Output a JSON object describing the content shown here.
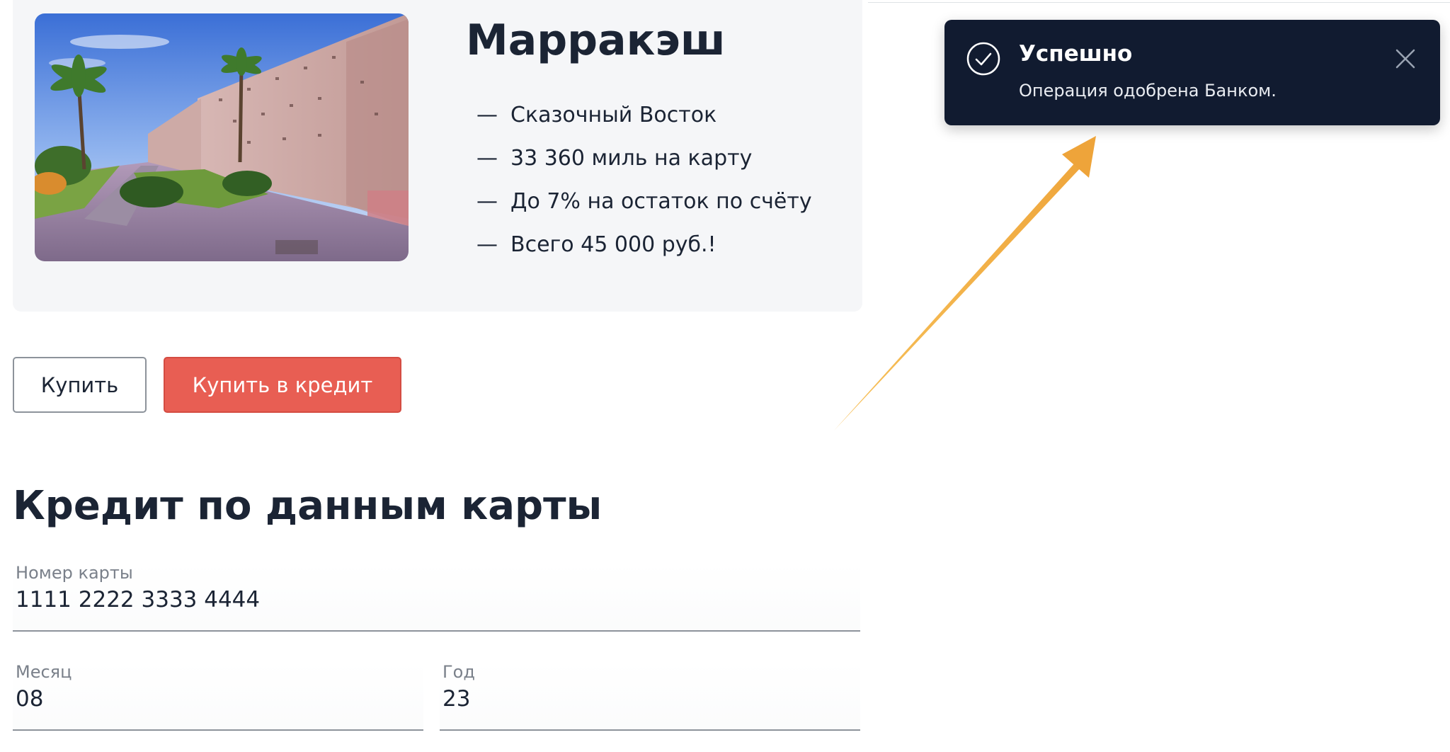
{
  "product": {
    "title": "Марракэш",
    "image_icon": "city-wall-photo",
    "features": [
      {
        "dash": "—",
        "text": "Сказочный Восток"
      },
      {
        "dash": "—",
        "text": "33 360 миль на карту"
      },
      {
        "dash": "—",
        "text": "До 7% на остаток по счёту"
      },
      {
        "dash": "—",
        "text": "Всего 45 000 руб.!"
      }
    ]
  },
  "actions": {
    "buy_label": "Купить",
    "buy_credit_label": "Купить в кредит"
  },
  "credit_form": {
    "title": "Кредит по данным карты",
    "card_number": {
      "label": "Номер карты",
      "value": "1111 2222 3333 4444"
    },
    "month": {
      "label": "Месяц",
      "value": "08"
    },
    "year": {
      "label": "Год",
      "value": "23"
    }
  },
  "notification": {
    "title": "Успешно",
    "message": "Операция одобрена Банком.",
    "icon": "check-circle-icon",
    "close_icon": "close-icon"
  },
  "colors": {
    "card_background": "#f5f6f8",
    "text_primary": "#1b2434",
    "accent_red": "#e85e53",
    "toast_background": "#111b30",
    "annotation_orange": "#f2a83a"
  }
}
